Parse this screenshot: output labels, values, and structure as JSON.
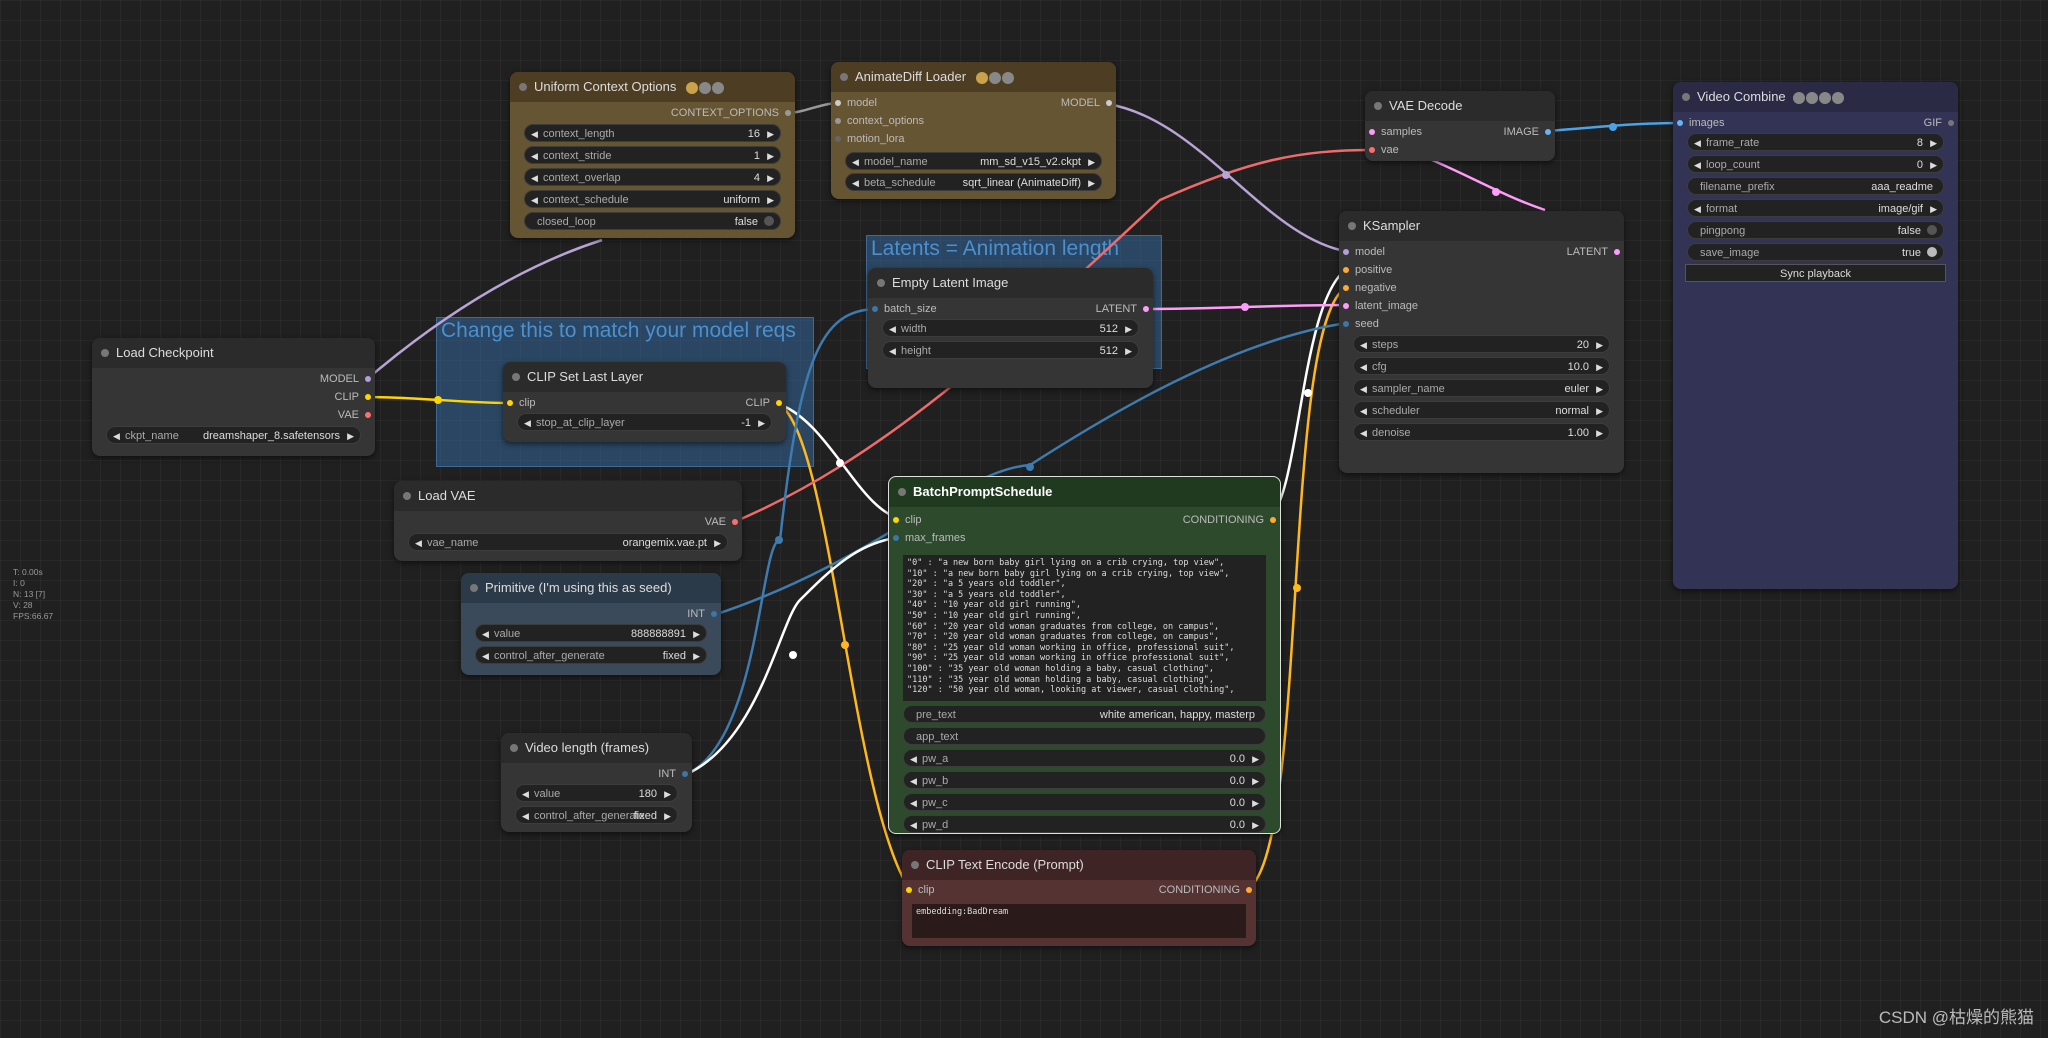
{
  "groups": {
    "latents": "Latents = Animation length",
    "model_reqs": "Change this to match your model reqs"
  },
  "nodes": {
    "uniform_context": {
      "title": "Uniform Context Options",
      "output": "CONTEXT_OPTIONS",
      "widgets": [
        {
          "label": "context_length",
          "value": "16"
        },
        {
          "label": "context_stride",
          "value": "1"
        },
        {
          "label": "context_overlap",
          "value": "4"
        },
        {
          "label": "context_schedule",
          "value": "uniform"
        }
      ],
      "closed_loop": {
        "label": "closed_loop",
        "value": "false"
      }
    },
    "animatediff": {
      "title": "AnimateDiff Loader",
      "inputs": [
        "model",
        "context_options",
        "motion_lora"
      ],
      "output": "MODEL",
      "widgets": [
        {
          "label": "model_name",
          "value": "mm_sd_v15_v2.ckpt"
        },
        {
          "label": "beta_schedule",
          "value": "sqrt_linear (AnimateDiff)"
        }
      ]
    },
    "vae_decode": {
      "title": "VAE Decode",
      "inputs": [
        "samples",
        "vae"
      ],
      "output": "IMAGE"
    },
    "video_combine": {
      "title": "Video Combine",
      "input": "images",
      "output": "GIF",
      "widgets": [
        {
          "label": "frame_rate",
          "value": "8"
        },
        {
          "label": "loop_count",
          "value": "0"
        }
      ],
      "filename_prefix": {
        "label": "filename_prefix",
        "value": "aaa_readme"
      },
      "format": {
        "label": "format",
        "value": "image/gif"
      },
      "pingpong": {
        "label": "pingpong",
        "value": "false"
      },
      "save_image": {
        "label": "save_image",
        "value": "true"
      },
      "sync_button": "Sync playback"
    },
    "ksampler": {
      "title": "KSampler",
      "inputs": [
        "model",
        "positive",
        "negative",
        "latent_image",
        "seed"
      ],
      "output": "LATENT",
      "widgets": [
        {
          "label": "steps",
          "value": "20"
        },
        {
          "label": "cfg",
          "value": "10.0"
        },
        {
          "label": "sampler_name",
          "value": "euler"
        },
        {
          "label": "scheduler",
          "value": "normal"
        },
        {
          "label": "denoise",
          "value": "1.00"
        }
      ]
    },
    "empty_latent": {
      "title": "Empty Latent Image",
      "input": "batch_size",
      "output": "LATENT",
      "widgets": [
        {
          "label": "width",
          "value": "512"
        },
        {
          "label": "height",
          "value": "512"
        }
      ]
    },
    "load_checkpoint": {
      "title": "Load Checkpoint",
      "outputs": [
        "MODEL",
        "CLIP",
        "VAE"
      ],
      "widget": {
        "label": "ckpt_name",
        "value": "dreamshaper_8.safetensors"
      }
    },
    "clip_set_last": {
      "title": "CLIP Set Last Layer",
      "input": "clip",
      "output": "CLIP",
      "widget": {
        "label": "stop_at_clip_layer",
        "value": "-1"
      }
    },
    "load_vae": {
      "title": "Load VAE",
      "output": "VAE",
      "widget": {
        "label": "vae_name",
        "value": "orangemix.vae.pt"
      }
    },
    "primitive": {
      "title": "Primitive (I'm using this as seed)",
      "output": "INT",
      "widgets": [
        {
          "label": "value",
          "value": "888888891"
        },
        {
          "label": "control_after_generate",
          "value": "fixed"
        }
      ]
    },
    "video_length": {
      "title": "Video length (frames)",
      "output": "INT",
      "widgets": [
        {
          "label": "value",
          "value": "180"
        },
        {
          "label": "control_after_generate",
          "value": "fixed"
        }
      ]
    },
    "batch_prompt": {
      "title": "BatchPromptSchedule",
      "inputs": [
        "clip",
        "max_frames"
      ],
      "output": "CONDITIONING",
      "text": "\"0\" : \"a new born baby girl lying on a crib crying, top view\",\n\"10\" : \"a new born baby girl lying on a crib crying, top view\",\n\"20\" : \"a 5 years old toddler\",\n\"30\" : \"a 5 years old toddler\",\n\"40\" : \"10 year old girl running\",\n\"50\" : \"10 year old girl running\",\n\"60\" : \"20 year old woman graduates from college, on campus\",\n\"70\" : \"20 year old woman graduates from college, on campus\",\n\"80\" : \"25 year old woman working in office, professional suit\",\n\"90\" : \"25 year old woman working in office professional suit\",\n\"100\" : \"35 year old woman holding a baby, casual clothing\",\n\"110\" : \"35 year old woman holding a baby, casual clothing\",\n\"120\" : \"50 year old woman, looking at viewer, casual clothing\",",
      "pre_text": {
        "label": "pre_text",
        "value": "white american, happy, masterp"
      },
      "app_text": {
        "label": "app_text",
        "value": ""
      },
      "widgets": [
        {
          "label": "pw_a",
          "value": "0.0"
        },
        {
          "label": "pw_b",
          "value": "0.0"
        },
        {
          "label": "pw_c",
          "value": "0.0"
        },
        {
          "label": "pw_d",
          "value": "0.0"
        }
      ]
    },
    "clip_text_encode": {
      "title": "CLIP Text Encode (Prompt)",
      "input": "clip",
      "output": "CONDITIONING",
      "text": "embedding:BadDream"
    }
  },
  "stats": "T: 0.00s\nI: 0\nN: 13 [7]\nV: 28\nFPS:66.67",
  "watermark": "CSDN @枯燥的熊猫",
  "colors": {
    "model": "#b39ddb",
    "clip": "#ffd500",
    "vae": "#ff6e6e",
    "latent": "#ff9cf9",
    "image": "#64b5f6",
    "int": "#3a78a8",
    "conditioning": "#ffa931",
    "context": "#999999"
  }
}
